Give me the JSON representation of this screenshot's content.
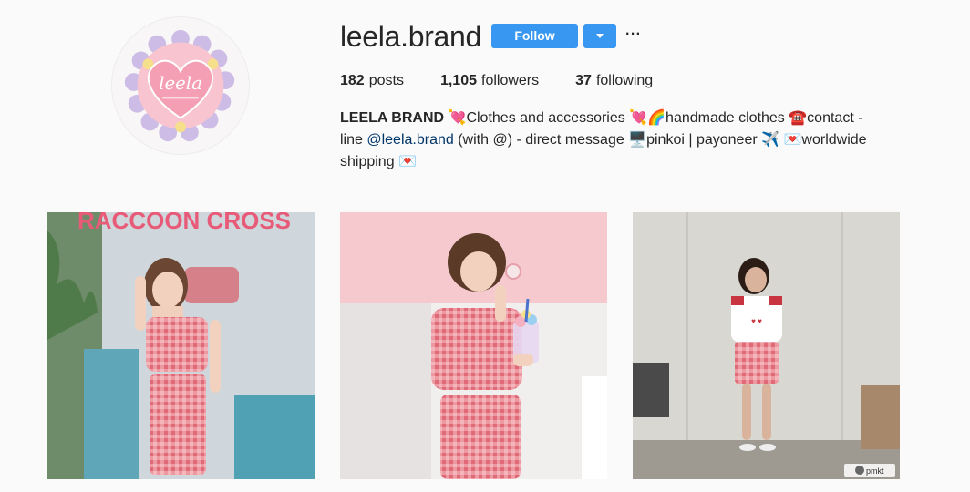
{
  "profile": {
    "username": "leela.brand",
    "avatar_text": "leela"
  },
  "header": {
    "follow_label": "Follow",
    "more_label": "···"
  },
  "stats": {
    "posts_count": "182",
    "posts_label": "posts",
    "followers_count": "1,105",
    "followers_label": "followers",
    "following_count": "37",
    "following_label": "following"
  },
  "bio": {
    "name": "LEELA BRAND",
    "line1": " 💘Clothes and accessories 💘🌈handmade clothes ☎️contact -",
    "line2_pre": "line ",
    "mention": "@leela.brand",
    "line2_post": " (with @) - direct message 🖥️pinkoi | payoneer ✈️ 💌worldwide",
    "line3": "shipping 💌"
  },
  "posts": [
    {
      "sign_text": "RACCOON CROSS",
      "alt": "girl in pink gingham outfit by window"
    },
    {
      "alt": "girl eating with drink in pink gingham set"
    },
    {
      "alt": "girl in white tee and pink skirt",
      "watermark": "pmkt"
    }
  ],
  "colors": {
    "accent": "#3897f0",
    "mention": "#003569",
    "gingham": "#e8707a"
  }
}
